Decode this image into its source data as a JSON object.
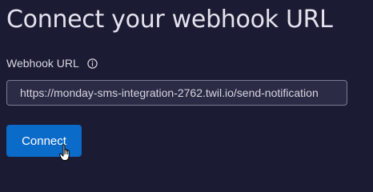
{
  "page": {
    "title": "Connect your webhook URL"
  },
  "webhook_field": {
    "label": "Webhook URL",
    "info_icon": "info-circle-icon",
    "value": "https://monday-sms-integration-2762.twil.io/send-notification"
  },
  "actions": {
    "connect_label": "Connect"
  },
  "cursor": {
    "icon": "hand-pointer-icon"
  },
  "colors": {
    "background": "#1b1b33",
    "field_background": "#2b2b45",
    "field_border": "#7c7c94",
    "primary": "#0b6bc8",
    "text": "#e3e3ee"
  }
}
